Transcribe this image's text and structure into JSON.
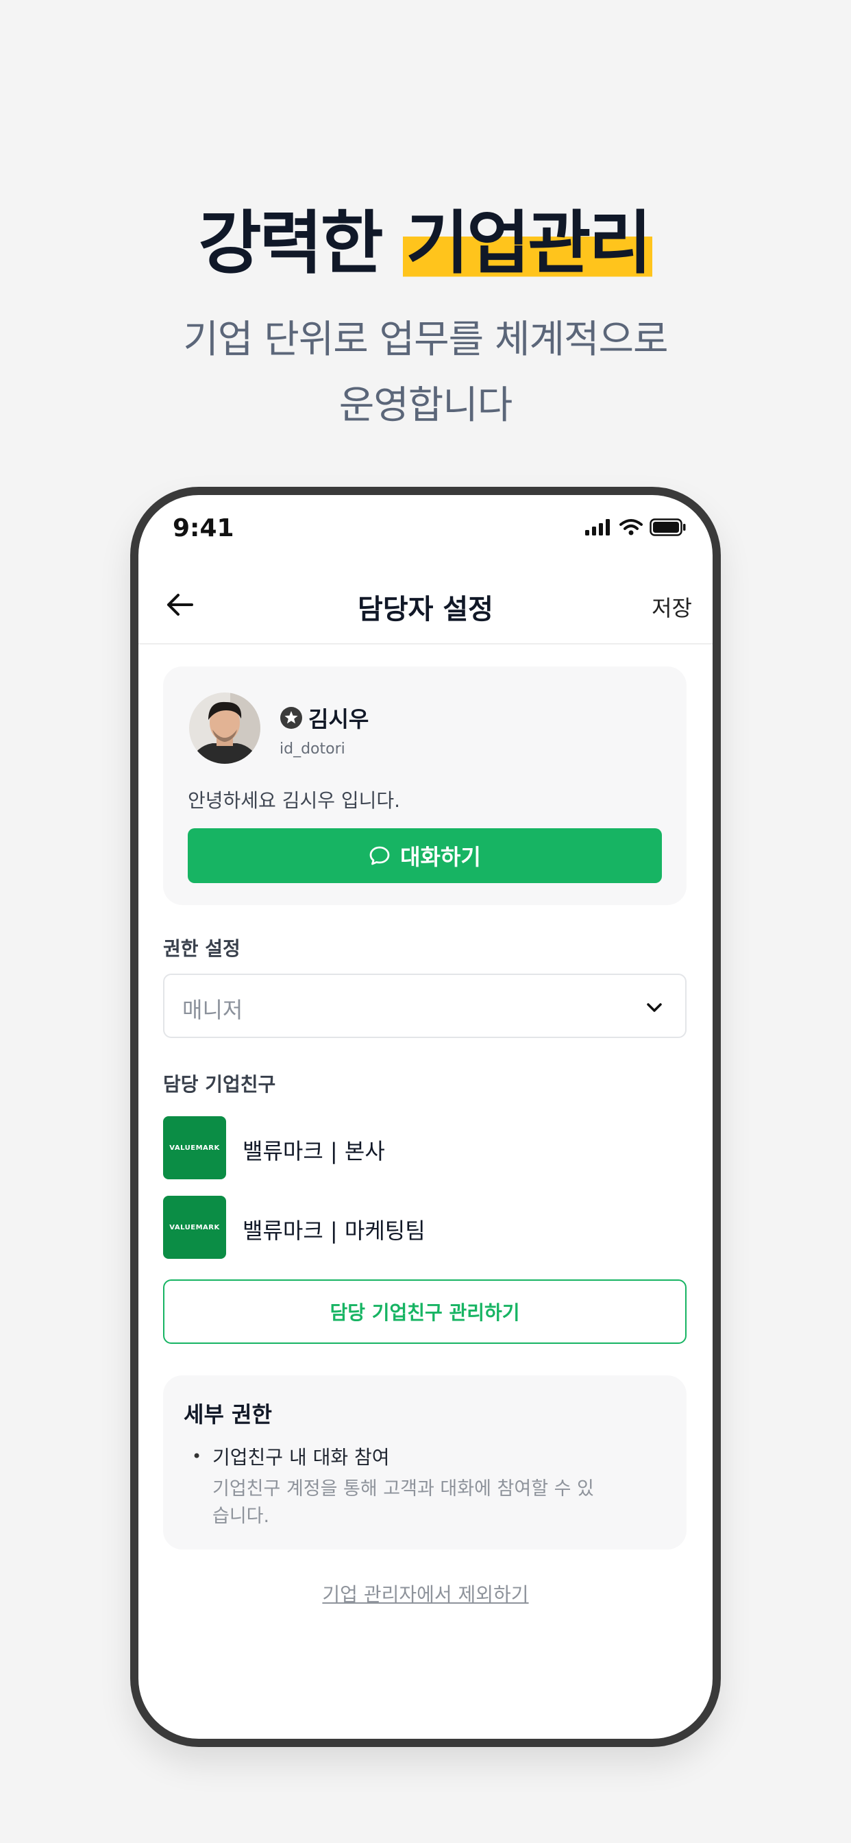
{
  "promo": {
    "title_plain": "강력한 ",
    "title_highlight": "기업관리",
    "subtitle_line1": "기업 단위로 업무를 체계적으로",
    "subtitle_line2": "운영합니다"
  },
  "status_bar": {
    "time": "9:41"
  },
  "nav": {
    "title": "담당자 설정",
    "save_label": "저장"
  },
  "profile": {
    "name": "김시우",
    "id": "id_dotori",
    "greeting": "안녕하세요 김시우 입니다.",
    "chat_button_label": "대화하기"
  },
  "role": {
    "label": "권한 설정",
    "selected": "매니저"
  },
  "companies": {
    "label": "담당 기업친구",
    "items": [
      {
        "logo_text": "VALUEMARK",
        "name": "밸류마크 | 본사"
      },
      {
        "logo_text": "VALUEMARK",
        "name": "밸류마크 | 마케팅팀"
      }
    ],
    "manage_button_label": "담당 기업친구 관리하기"
  },
  "permissions": {
    "title": "세부 권한",
    "bullet": "•",
    "item_title": "기업친구 내 대화 참여",
    "item_desc": "기업친구 계정을 통해 고객과 대화에 참여할 수 있습니다."
  },
  "remove_link_label": "기업 관리자에서 제외하기",
  "colors": {
    "accent_green": "#17b463",
    "logo_green": "#0b8d45",
    "highlight_yellow": "#ffc41c",
    "frame": "#3a3a3a"
  }
}
